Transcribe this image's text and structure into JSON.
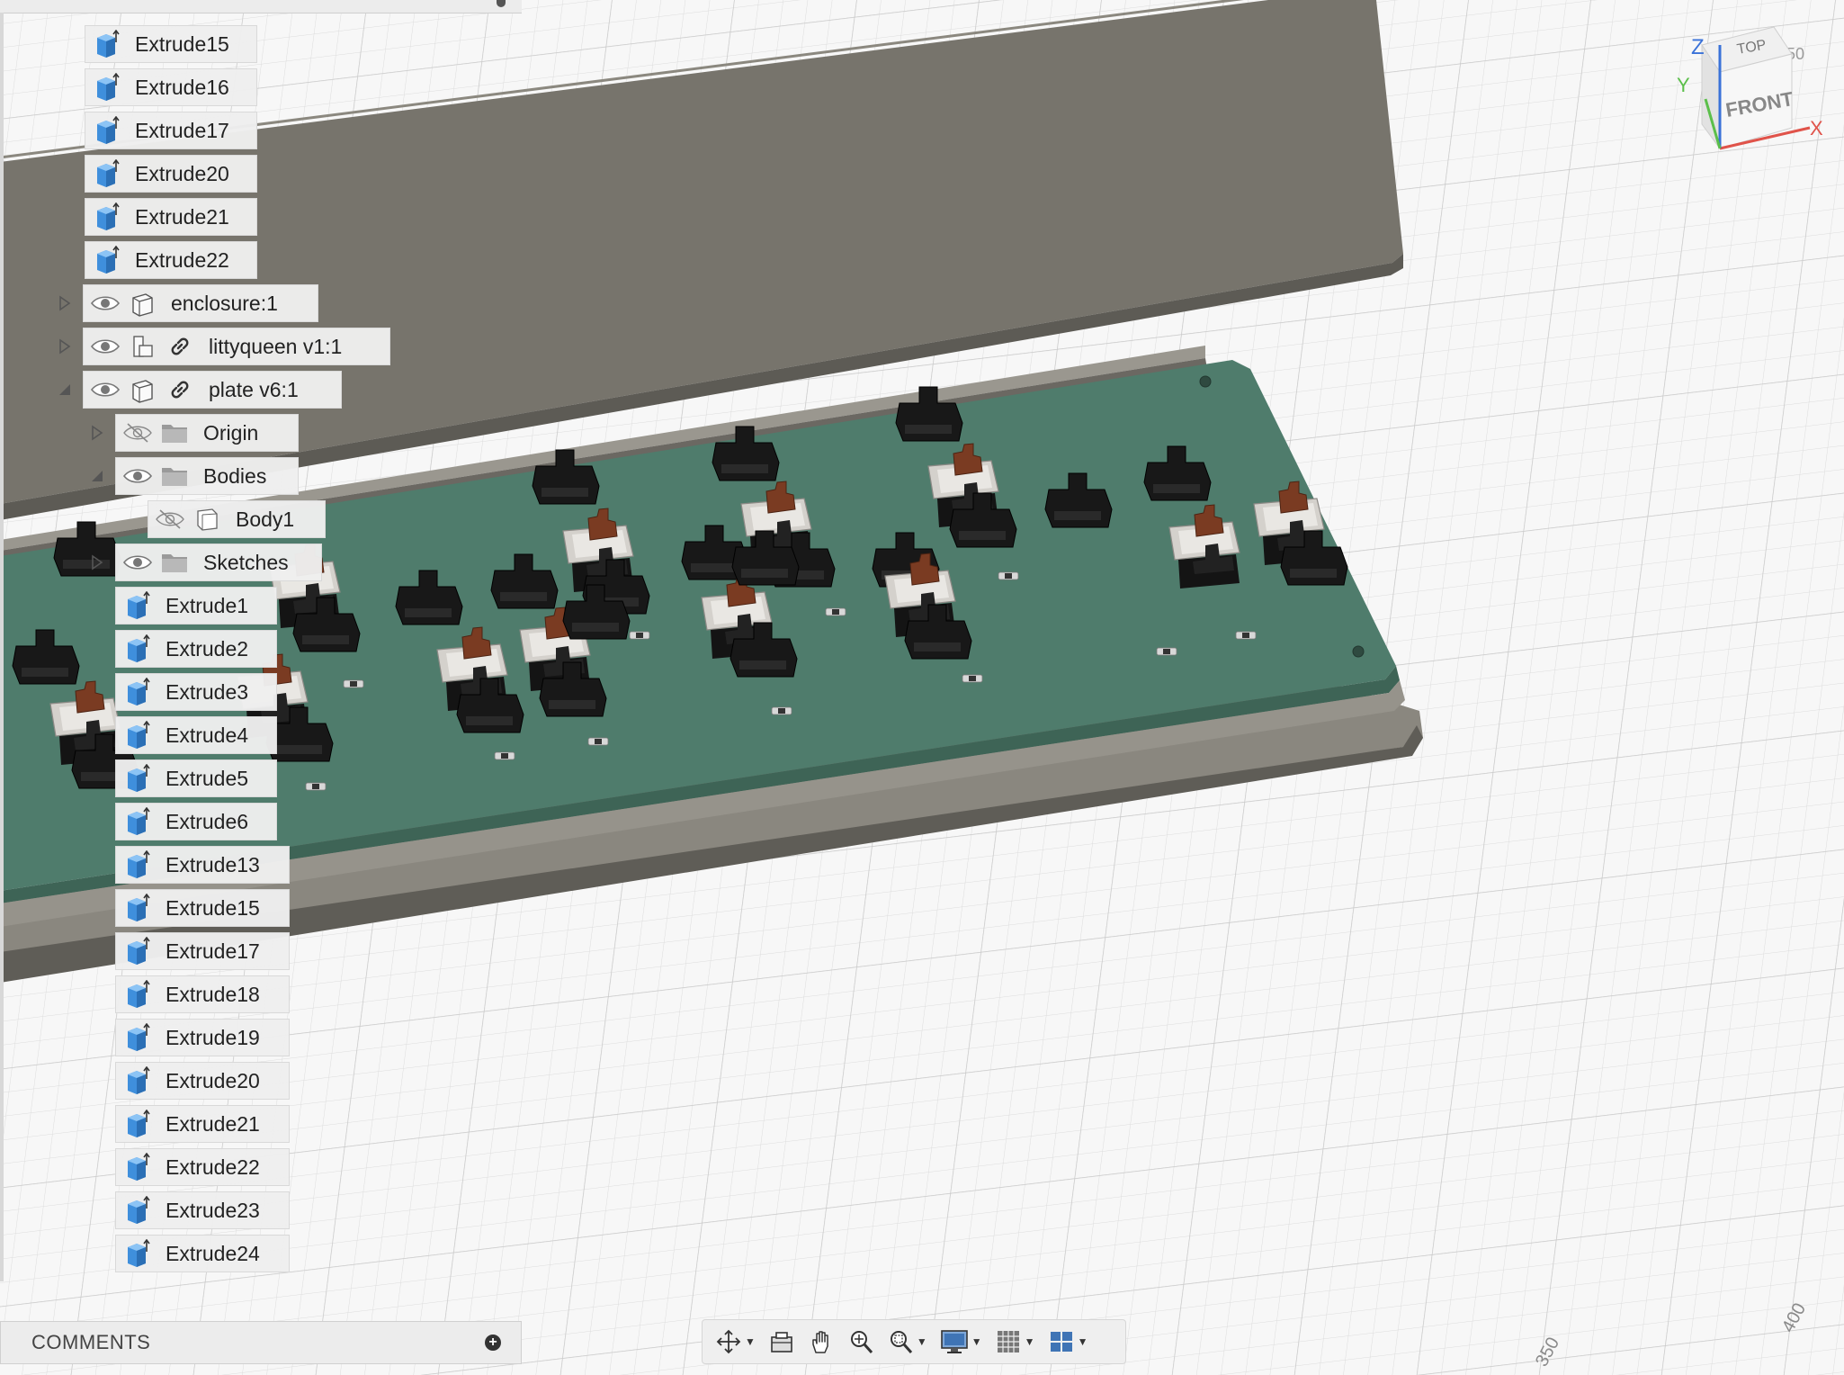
{
  "browser": {
    "rows": [
      {
        "kind": "body-feature",
        "label": "Extrude15"
      },
      {
        "kind": "body-feature",
        "label": "Extrude16"
      },
      {
        "kind": "body-feature",
        "label": "Extrude17"
      },
      {
        "kind": "body-feature",
        "label": "Extrude20"
      },
      {
        "kind": "body-feature",
        "label": "Extrude21"
      },
      {
        "kind": "body-feature",
        "label": "Extrude22"
      },
      {
        "kind": "component",
        "label": "enclosure:1",
        "expander": "collapsed",
        "visible": true,
        "linked": false
      },
      {
        "kind": "component",
        "label": "littyqueen v1:1",
        "expander": "collapsed",
        "visible": true,
        "linked": true
      },
      {
        "kind": "component",
        "label": "plate v6:1",
        "expander": "expanded",
        "visible": true,
        "linked": true
      },
      {
        "kind": "folder",
        "label": "Origin",
        "expander": "collapsed",
        "visible": false
      },
      {
        "kind": "folder",
        "label": "Bodies",
        "expander": "expanded",
        "visible": true
      },
      {
        "kind": "body",
        "label": "Body1",
        "visible": false
      },
      {
        "kind": "folder",
        "label": "Sketches",
        "expander": "collapsed",
        "visible": true
      },
      {
        "kind": "body-feature",
        "label": "Extrude1"
      },
      {
        "kind": "body-feature",
        "label": "Extrude2"
      },
      {
        "kind": "body-feature",
        "label": "Extrude3"
      },
      {
        "kind": "body-feature",
        "label": "Extrude4"
      },
      {
        "kind": "body-feature",
        "label": "Extrude5"
      },
      {
        "kind": "body-feature",
        "label": "Extrude6"
      },
      {
        "kind": "body-feature",
        "label": "Extrude13"
      },
      {
        "kind": "body-feature",
        "label": "Extrude15"
      },
      {
        "kind": "body-feature",
        "label": "Extrude17"
      },
      {
        "kind": "body-feature",
        "label": "Extrude18"
      },
      {
        "kind": "body-feature",
        "label": "Extrude19"
      },
      {
        "kind": "body-feature",
        "label": "Extrude20"
      },
      {
        "kind": "body-feature",
        "label": "Extrude21"
      },
      {
        "kind": "body-feature",
        "label": "Extrude22"
      },
      {
        "kind": "body-feature",
        "label": "Extrude23"
      },
      {
        "kind": "body-feature",
        "label": "Extrude24"
      }
    ]
  },
  "comments": {
    "title": "COMMENTS",
    "add_icon": "plus-circle-icon"
  },
  "viewcube": {
    "top": "TOP",
    "front": "FRONT",
    "axis_x": "X",
    "axis_y": "Y",
    "axis_z": "Z"
  },
  "grid_labels": {
    "tick_350": "350",
    "tick_400": "400",
    "tick_50": "50"
  },
  "toolbar": {
    "tools": [
      {
        "icon": "orbit-icon",
        "dropdown": true
      },
      {
        "icon": "look-at-icon",
        "dropdown": false
      },
      {
        "icon": "pan-hand-icon",
        "dropdown": false
      },
      {
        "icon": "zoom-icon",
        "dropdown": false
      },
      {
        "icon": "zoom-window-icon",
        "dropdown": true
      },
      {
        "icon": "display-settings-icon",
        "dropdown": true
      },
      {
        "icon": "grid-settings-icon",
        "dropdown": true
      },
      {
        "icon": "viewports-icon",
        "dropdown": true
      }
    ]
  },
  "colors": {
    "pcb": "#4f7c6c",
    "enclosure": "#77746c",
    "switch_housing": "#1b1b1b",
    "switch_stem": "#7a3b22",
    "extrude_icon": "#3f8fdc"
  }
}
